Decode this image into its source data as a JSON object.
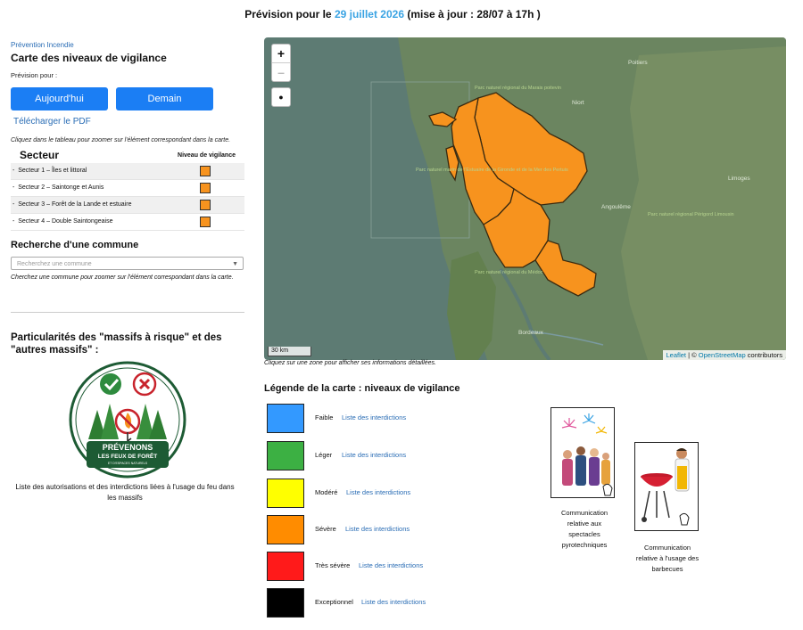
{
  "header": {
    "prefix": "Prévision pour le ",
    "date": "29 juillet 2026",
    "suffix": " (mise à jour : 28/07 à 17h )"
  },
  "left": {
    "crumb": "Prévention Incendie",
    "title": "Carte des niveaux de vigilance",
    "forecast_label": "Prévision pour :",
    "btn_today": "Aujourd'hui",
    "btn_tomorrow": "Demain",
    "pdf_link": "Télécharger le PDF",
    "table_hint": "Cliquez dans le tableau pour zoomer sur l'élément correspondant dans la carte.",
    "table": {
      "col_sector": "Secteur",
      "col_level": "Niveau de vigilance",
      "rows": [
        {
          "label": "Secteur 1 – Îles et littoral",
          "color": "#f7931e"
        },
        {
          "label": "Secteur 2 – Saintonge et Aunis",
          "color": "#f7931e"
        },
        {
          "label": "Secteur 3 – Forêt de la Lande et estuaire",
          "color": "#f7931e"
        },
        {
          "label": "Secteur 4 – Double Saintongeaise",
          "color": "#f7931e"
        }
      ]
    },
    "search_title": "Recherche d'une commune",
    "search_placeholder": "Recherchez une commune",
    "search_hint": "Cherchez une commune pour zoomer sur l'élément correspondant dans la carte.",
    "massif_title": "Particularités des \"massifs à risque\" et des \"autres massifs\" :",
    "badge": {
      "line1": "PRÉVENONS",
      "line2": "LES FEUX DE FORÊT",
      "line3": "ET D'ESPACES NATURELS"
    },
    "massif_desc": "Liste des autorisations et des interdictions liées à l'usage du feu dans les massifs"
  },
  "map": {
    "zoom_in": "+",
    "zoom_out": "–",
    "scale": "30 km",
    "attrib_leaflet": "Leaflet",
    "attrib_sep": " | © ",
    "attrib_osm": "OpenStreetMap",
    "attrib_suffix": " contributors",
    "hint": "Cliquez sur une zone pour afficher ses informations détaillées.",
    "places": {
      "niort": "Niort",
      "poitiers": "Poitiers",
      "angouleme": "Angoulême",
      "limoges": "Limoges",
      "bordeaux": "Bordeaux",
      "pnr_marais": "Parc naturel régional du Marais poitevin",
      "pnr_estuaire": "Parc naturel marin de l'Estuaire de la Gironde et de la Mer des Pertuis",
      "pnr_medoc": "Parc naturel régional du Médoc",
      "pnr_perigord": "Parc naturel régional Périgord Limousin"
    },
    "zone_color": "#f7931e"
  },
  "legend": {
    "title": "Légende de la carte : niveaux de vigilance",
    "link_label": "Liste des interdictions",
    "levels": [
      {
        "name": "Faible",
        "color": "#3399ff"
      },
      {
        "name": "Léger",
        "color": "#3cb043"
      },
      {
        "name": "Modéré",
        "color": "#ffff00"
      },
      {
        "name": "Sévère",
        "color": "#ff8c00"
      },
      {
        "name": "Très sévère",
        "color": "#ff1a1a"
      },
      {
        "name": "Exceptionnel",
        "color": "#000000"
      }
    ]
  },
  "comms": {
    "pyro": "Communication relative aux spectacles pyrotechniques",
    "bbq": "Communication relative à l'usage des barbecues"
  }
}
